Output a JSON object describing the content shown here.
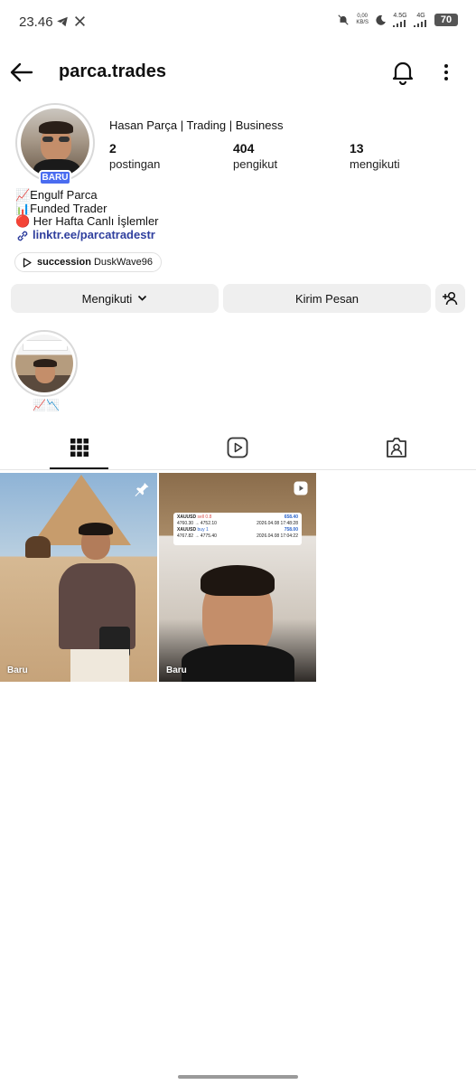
{
  "status_bar": {
    "time": "23.46",
    "speed_value": "0,00",
    "speed_unit": "KB/S",
    "net1": "4.5G",
    "net2": "4G",
    "battery": "70"
  },
  "header": {
    "username": "parca.trades",
    "icons": [
      "back-arrow-icon",
      "bell-icon",
      "more-vertical-icon"
    ]
  },
  "profile": {
    "badge": "BARU",
    "display_name": "Hasan Parça | Trading | Business",
    "stats": [
      {
        "value": "2",
        "label": "postingan"
      },
      {
        "value": "404",
        "label": "pengikut"
      },
      {
        "value": "13",
        "label": "mengikuti"
      }
    ],
    "bio": [
      "📈Engulf Parca",
      "📊Funded Trader",
      "🔴 Her Hafta Canlı İşlemler"
    ],
    "link": "linktr.ee/parcatradestr",
    "music": {
      "title": "succession",
      "artist": "DuskWave96"
    }
  },
  "actions": {
    "following": "Mengikuti",
    "message": "Kirim Pesan"
  },
  "highlights": [
    {
      "label": "📈📉"
    }
  ],
  "tabs": [
    "grid-icon",
    "reels-icon",
    "tagged-icon"
  ],
  "posts": [
    {
      "label": "Baru",
      "icon": "pin-icon"
    },
    {
      "label": "Baru",
      "icon": "reel-play-icon",
      "trade_card": {
        "row1": {
          "symbol": "XAUUSD",
          "side": "sell 0.8",
          "profit": "658.40",
          "prices": "4760.30 → 4752.10",
          "time": "2026.04.08 17:48:28"
        },
        "row2": {
          "symbol": "XAUUSD",
          "side": "buy 1",
          "profit": "758.00",
          "prices": "4767.82 → 4775.40",
          "time": "2026.04.08 17:04:22"
        }
      }
    }
  ],
  "colors": {
    "link": "#2f3f9e",
    "badge": "#4a6cf0",
    "button_bg": "#efefef",
    "profit": "#2a62c9",
    "sell": "#d9534f"
  }
}
